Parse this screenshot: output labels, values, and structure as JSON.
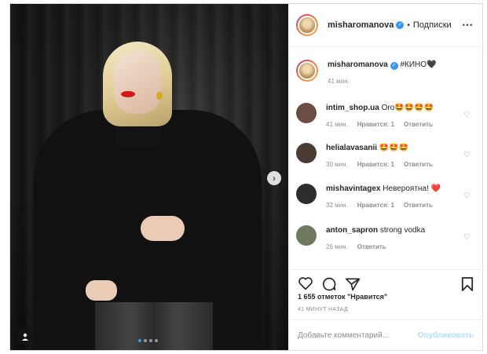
{
  "post": {
    "username": "misharomanova",
    "follow_label": "Подписки",
    "caption_text": "#КИНО🖤",
    "caption_time": "41 мин.",
    "likes": "1 655 отметок \"Нравится\"",
    "posted_ago": "41 МИНУТ НАЗАД"
  },
  "comments": [
    {
      "user": "intim_shop.ua",
      "text": "Oro🤩🤩🤩🤩",
      "time": "41 мин.",
      "likes": "Нравится: 1",
      "reply": "Ответить",
      "avatar_color": "#6b4d44"
    },
    {
      "user": "helialavasanii",
      "text": "🤩🤩🤩",
      "time": "30 мин.",
      "likes": "Нравится: 1",
      "reply": "Ответить",
      "avatar_color": "#4a3b35"
    },
    {
      "user": "mishavintagex",
      "text": "Невероятна! ❤️",
      "time": "32 мин.",
      "likes": "Нравится: 1",
      "reply": "Ответить",
      "avatar_color": "#2d2d2d"
    },
    {
      "user": "anton_sapron",
      "text": "strong vodka",
      "time": "26 мин.",
      "likes": "",
      "reply": "Ответить",
      "avatar_color": "#6e7a5d"
    }
  ],
  "add_comment": {
    "placeholder": "Добавьте комментарий...",
    "publish_label": "Опубликовать"
  },
  "icons": {
    "more": "⋯",
    "verified": "✓",
    "heart": "♡",
    "next": "›",
    "user_tag": "●"
  },
  "colors": {
    "accent": "#3897f0",
    "publish_disabled": "#b2dffc",
    "muted": "#8e8e8e"
  }
}
